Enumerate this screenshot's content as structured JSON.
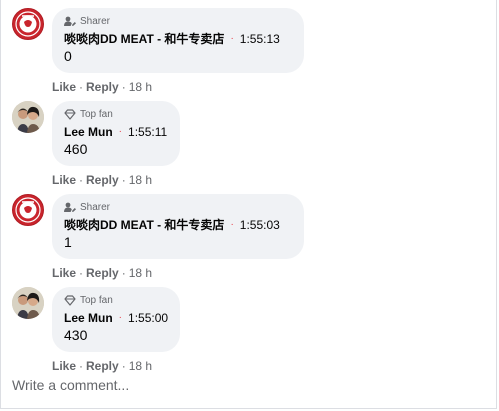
{
  "comments": [
    {
      "badge": "Sharer",
      "badge_icon": "person-pen-icon",
      "author": "啖啖肉DD MEAT - 和牛专卖店",
      "time": "1:55:13",
      "text": "0",
      "like_label": "Like",
      "reply_label": "Reply",
      "ago": "18 h",
      "avatar_type": "logo"
    },
    {
      "badge": "Top fan",
      "badge_icon": "diamond-icon",
      "author": "Lee Mun",
      "time": "1:55:11",
      "text": "460",
      "like_label": "Like",
      "reply_label": "Reply",
      "ago": "18 h",
      "avatar_type": "photo"
    },
    {
      "badge": "Sharer",
      "badge_icon": "person-pen-icon",
      "author": "啖啖肉DD MEAT - 和牛专卖店",
      "time": "1:55:03",
      "text": "1",
      "like_label": "Like",
      "reply_label": "Reply",
      "ago": "18 h",
      "avatar_type": "logo"
    },
    {
      "badge": "Top fan",
      "badge_icon": "diamond-icon",
      "author": "Lee Mun",
      "time": "1:55:00",
      "text": "430",
      "like_label": "Like",
      "reply_label": "Reply",
      "ago": "18 h",
      "avatar_type": "photo"
    }
  ],
  "composer": {
    "placeholder": "Write a comment..."
  },
  "colors": {
    "bubble": "#f0f2f5",
    "secondary_text": "#65676b",
    "dot": "#e8414a",
    "logo_red": "#c9252d"
  }
}
